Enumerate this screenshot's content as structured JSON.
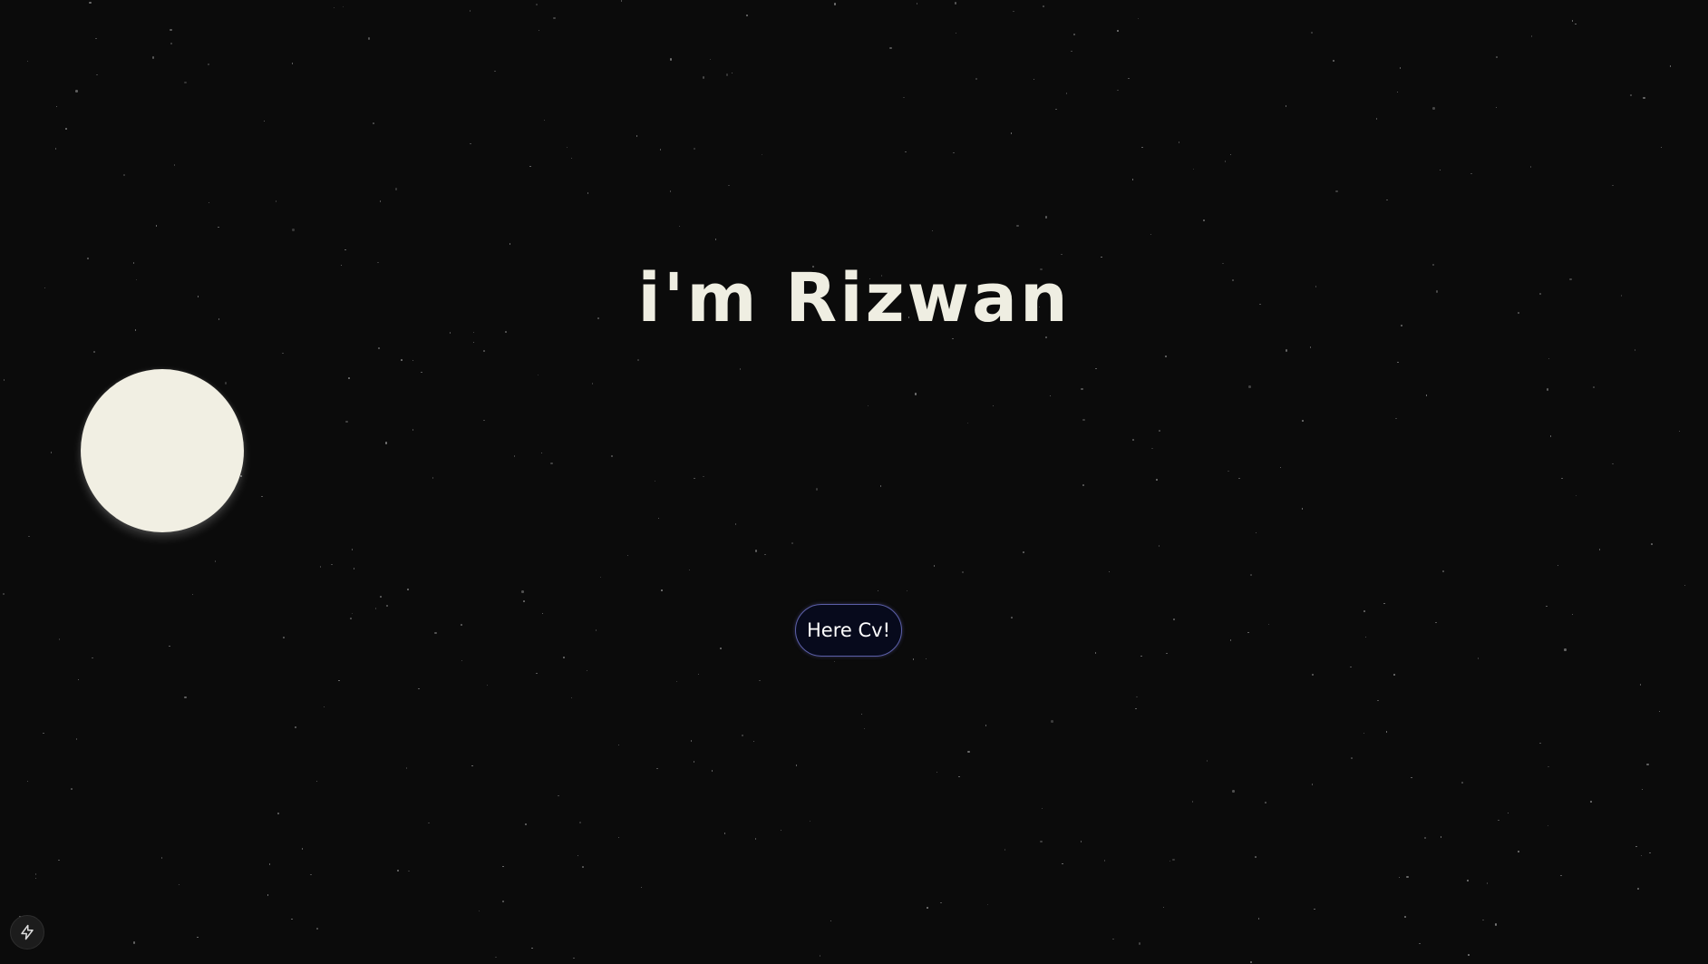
{
  "hero": {
    "title": "i'm Rizwan"
  },
  "cta": {
    "label": "Here Cv!"
  },
  "icons": {
    "moon": "moon-circle",
    "quick_action": "lightning-bolt-icon"
  },
  "colors": {
    "background": "#0b0b0b",
    "title_text": "#efeee2",
    "moon": "#f1efe3",
    "button_fill": "#070a1c",
    "button_border": "#5b5fa8",
    "stars": "#8a8a8a"
  }
}
